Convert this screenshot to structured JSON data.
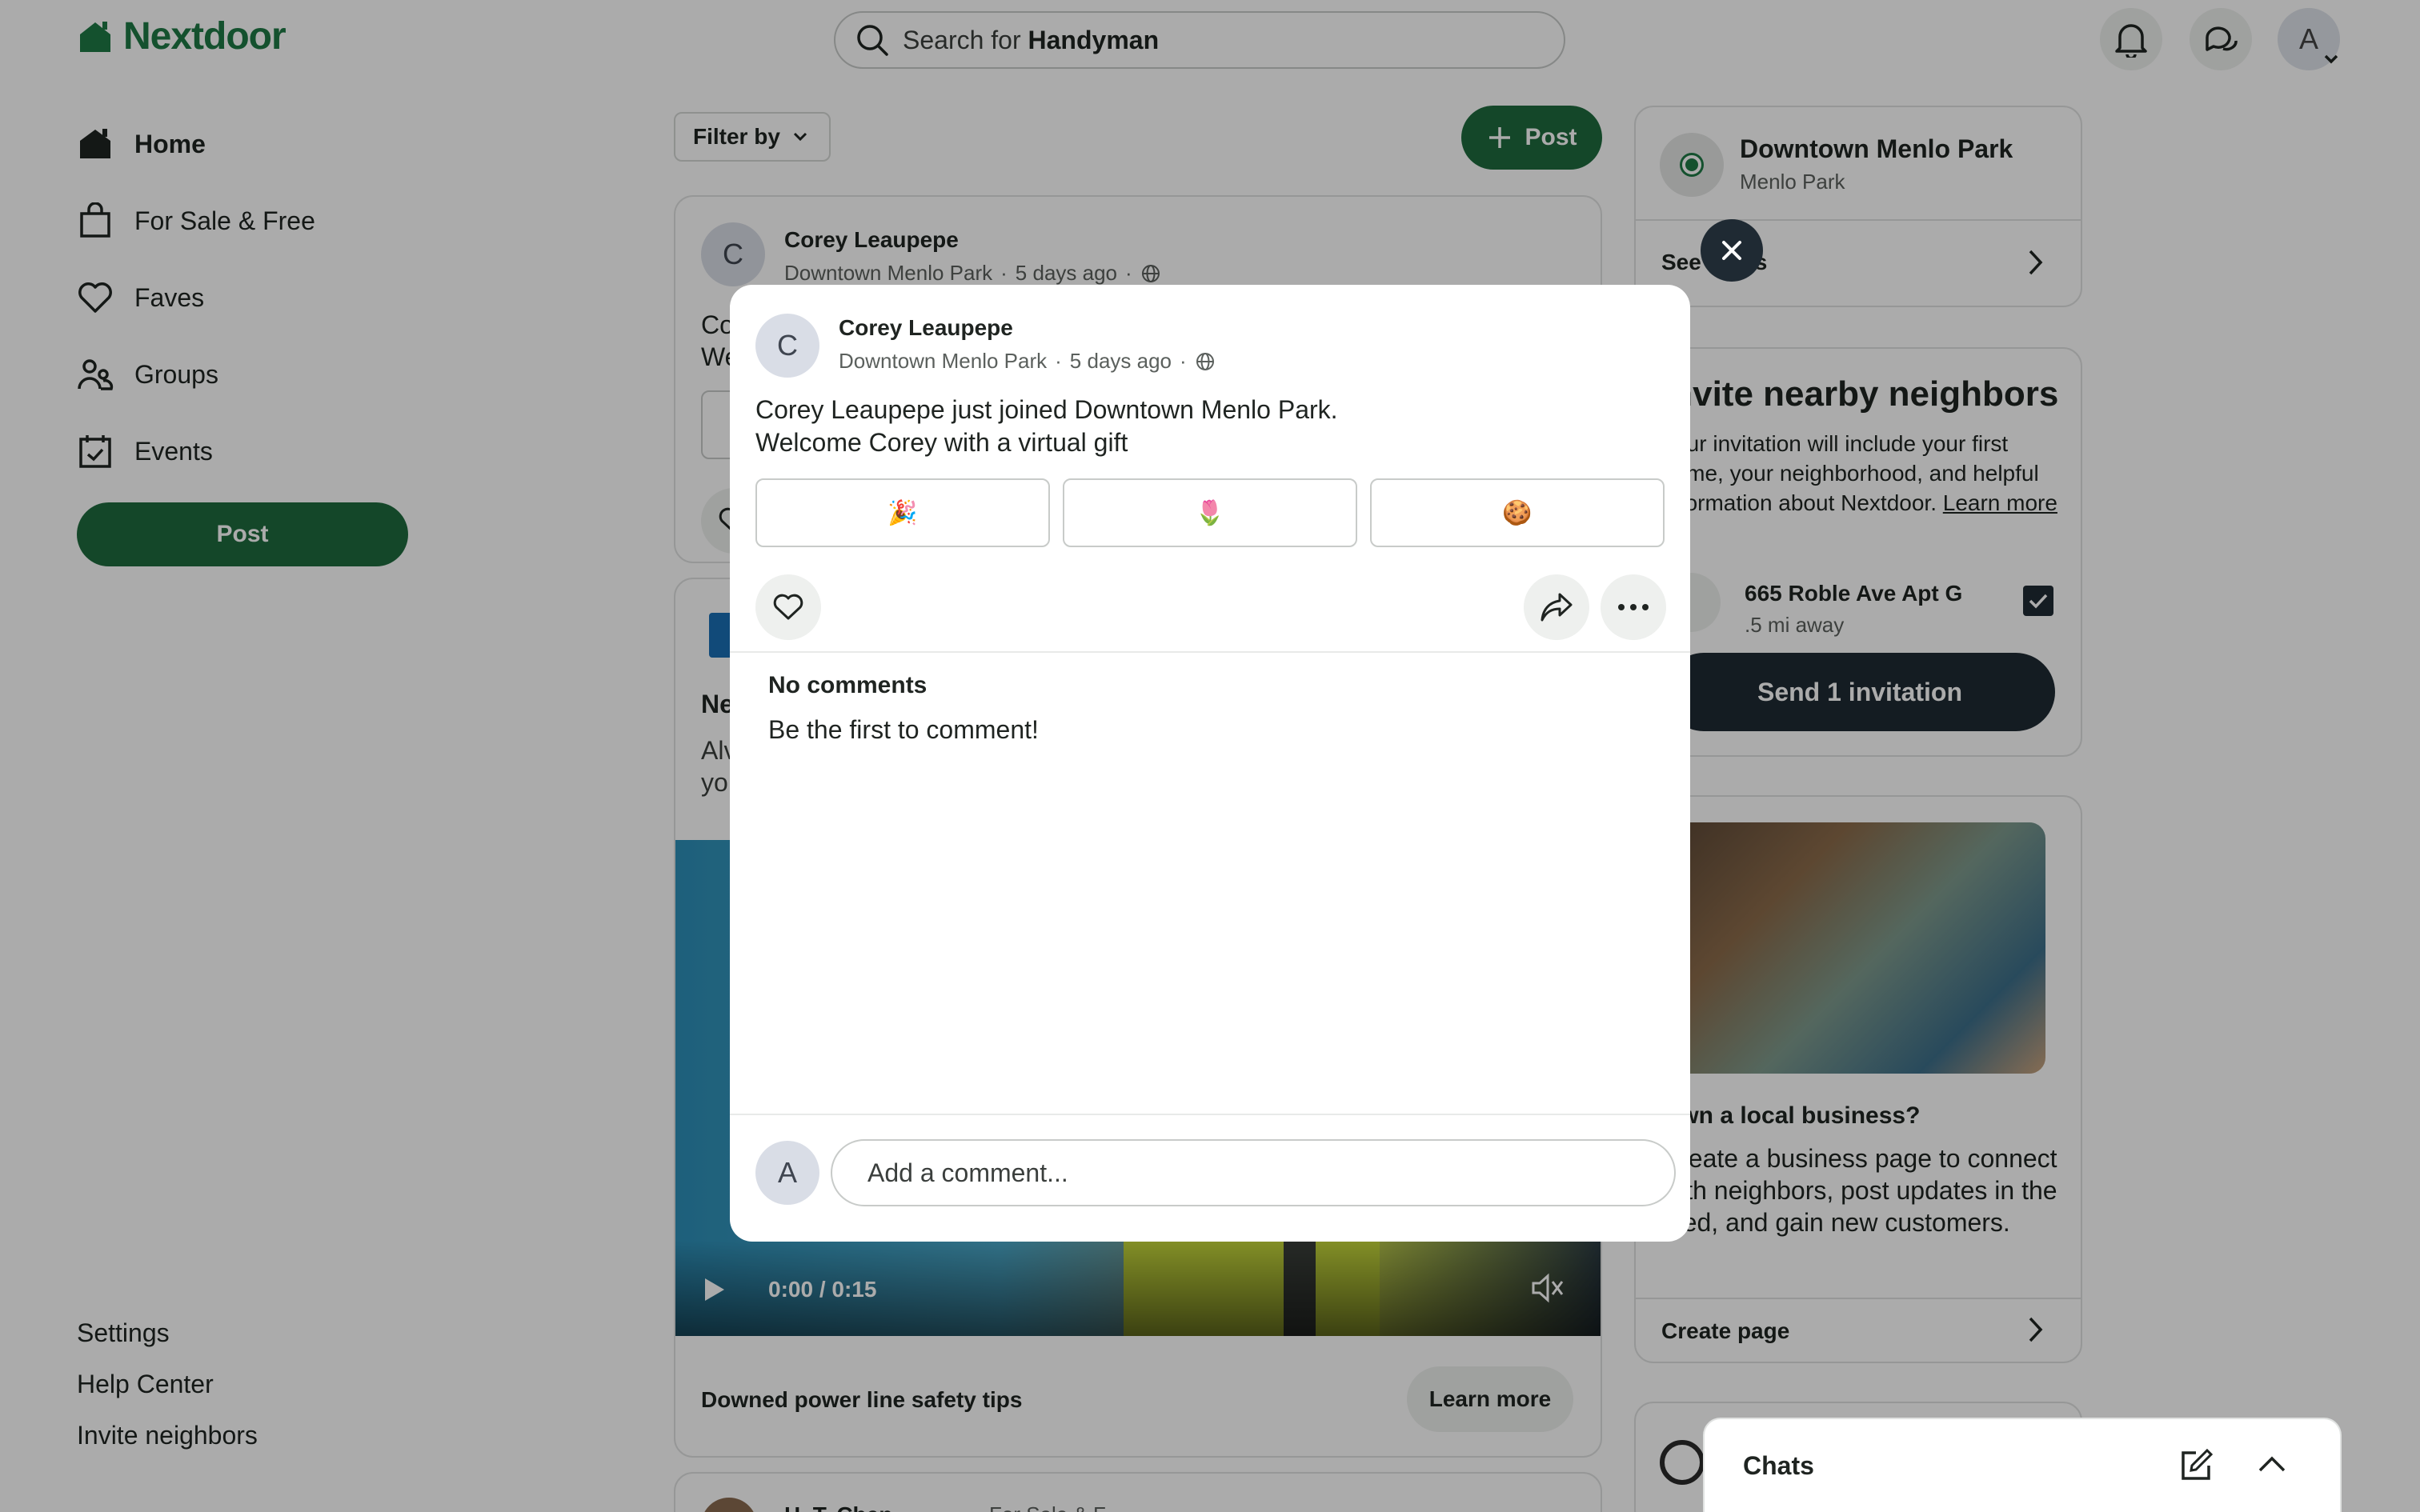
{
  "header": {
    "brand": "Nextdoor",
    "search_prefix": "Search for ",
    "search_term": "Handyman",
    "user_initial": "A"
  },
  "sidebar": {
    "items": [
      {
        "label": "Home",
        "icon": "home-icon",
        "active": true
      },
      {
        "label": "For Sale & Free",
        "icon": "shopping-bag-icon"
      },
      {
        "label": "Faves",
        "icon": "heart-icon"
      },
      {
        "label": "Groups",
        "icon": "groups-icon"
      },
      {
        "label": "Events",
        "icon": "calendar-icon"
      }
    ],
    "post_label": "Post",
    "footer_links": [
      "Settings",
      "Help Center",
      "Invite neighbors"
    ]
  },
  "feed": {
    "filter_label": "Filter by",
    "post_label": "Post",
    "post1": {
      "initial": "C",
      "author": "Corey Leaupepe",
      "neighborhood": "Downtown Menlo Park",
      "time": "5 days ago",
      "text_fragments": [
        "Co",
        "We"
      ]
    },
    "post2": {
      "title_fragment": "Ne",
      "text_fragments": [
        "Alv",
        "yo"
      ],
      "video_time": "0:00 / 0:15",
      "caption": "Downed power line safety tips",
      "cta": "Learn more"
    },
    "post3": {
      "author_fragment": "H. T. Chen",
      "category_fragment": "For Sale & F"
    }
  },
  "right": {
    "neighborhood": {
      "name": "Downtown Menlo Park",
      "city": "Menlo Park",
      "see_link": "See alerts"
    },
    "invite": {
      "title": "Invite nearby neighbors",
      "body": "Your invitation will include your first name, your neighborhood, and helpful information about Nextdoor.",
      "learn_more": "Learn more",
      "address": "665 Roble Ave Apt G",
      "distance": ".5 mi away",
      "send_label": "Send 1 invitation"
    },
    "business": {
      "title": "Own a local business?",
      "body": "Create a business page to connect with neighbors, post updates in the feed, and gain new customers.",
      "cta": "Create page"
    }
  },
  "modal": {
    "initial": "C",
    "author": "Corey Leaupepe",
    "neighborhood": "Downtown Menlo Park",
    "time": "5 days ago",
    "line1": "Corey Leaupepe just joined Downtown Menlo Park.",
    "line2": "Welcome Corey with a virtual gift",
    "gifts": [
      "🎉",
      "🌷",
      "🍪"
    ],
    "no_comments": "No comments",
    "be_first": "Be the first to comment!",
    "commenter_initial": "A",
    "comment_placeholder": "Add a comment..."
  },
  "chats": {
    "label": "Chats"
  },
  "colors": {
    "brand_green": "#1f7a45",
    "button_green": "#1f6b3e",
    "dark_navy": "#1f2a33"
  }
}
